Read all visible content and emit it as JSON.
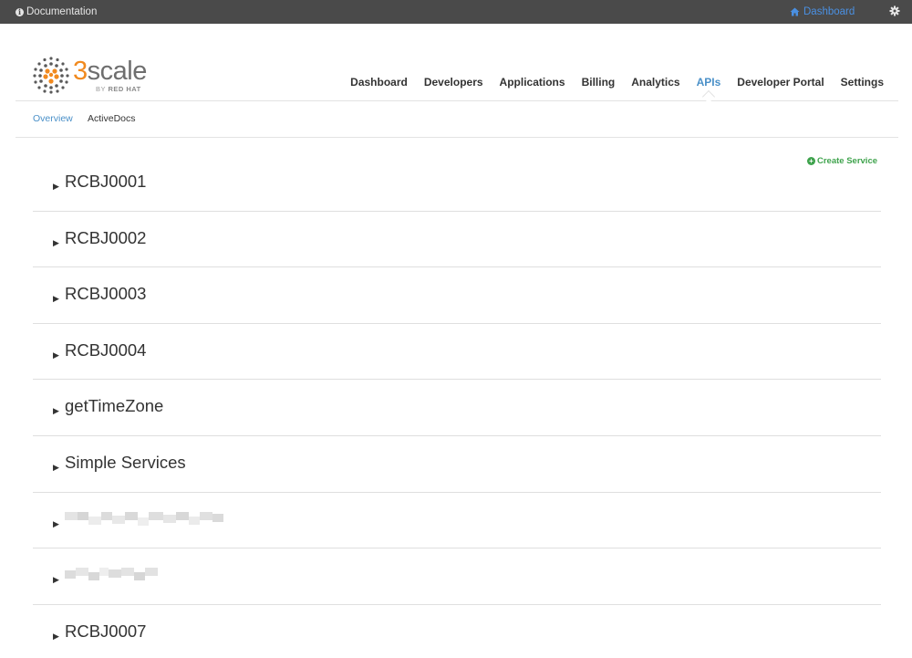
{
  "topbar": {
    "documentation_label": "Documentation",
    "dashboard_label": "Dashboard"
  },
  "logo": {
    "word_accent": "3",
    "word_rest": "scale",
    "byline_prefix": "BY ",
    "byline_brand": "RED HAT"
  },
  "nav": {
    "items": [
      {
        "label": "Dashboard"
      },
      {
        "label": "Developers"
      },
      {
        "label": "Applications"
      },
      {
        "label": "Billing"
      },
      {
        "label": "Analytics"
      },
      {
        "label": "APIs",
        "active": true
      },
      {
        "label": "Developer Portal"
      },
      {
        "label": "Settings"
      }
    ]
  },
  "subnav": {
    "overview": "Overview",
    "activedocs": "ActiveDocs"
  },
  "create_service_label": "Create Service",
  "services": [
    {
      "name": "RCBJ0001"
    },
    {
      "name": "RCBJ0002"
    },
    {
      "name": "RCBJ0003"
    },
    {
      "name": "RCBJ0004"
    },
    {
      "name": "getTimeZone"
    },
    {
      "name": "Simple Services"
    },
    {
      "name": "",
      "redacted": true
    },
    {
      "name": "",
      "redacted": true
    },
    {
      "name": "RCBJ0007"
    }
  ],
  "colors": {
    "topbar_bg": "#4a4a4a",
    "link_blue": "#4a90c8",
    "accent_orange": "#f18a1f",
    "create_green": "#3fa34d"
  }
}
